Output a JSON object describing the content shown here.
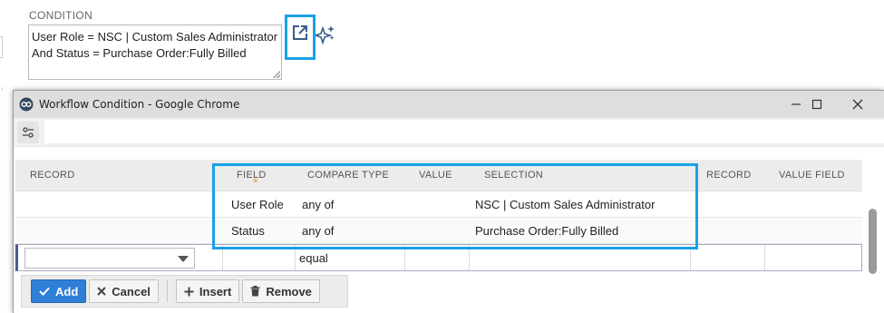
{
  "background": {
    "condition_label": "CONDITION",
    "condition_text": "User Role = NSC | Custom Sales Administrator And Status = Purchase Order:Fully Billed"
  },
  "icons": {
    "open_popup": "open-external-icon",
    "ai_assist": "sparkle-icon"
  },
  "popup": {
    "title": "Workflow Condition - Google Chrome",
    "window_controls": [
      "minimize",
      "maximize",
      "close"
    ],
    "grid": {
      "headers": [
        "RECORD",
        "FIELD",
        "COMPARE TYPE",
        "VALUE",
        "SELECTION",
        "RECORD",
        "VALUE FIELD"
      ],
      "required_marker": "*",
      "rows": [
        {
          "record": "",
          "field": "User Role",
          "compare_type": "any of",
          "value": "",
          "selection": "NSC | Custom Sales Administrator",
          "record2": "",
          "value_field": ""
        },
        {
          "record": "",
          "field": "Status",
          "compare_type": "any of",
          "value": "",
          "selection": "Purchase Order:Fully Billed",
          "record2": "",
          "value_field": ""
        }
      ],
      "edit_row": {
        "record_select": "",
        "compare_type": "equal"
      }
    },
    "buttons": {
      "add": "Add",
      "cancel": "Cancel",
      "insert": "Insert",
      "remove": "Remove"
    }
  },
  "colors": {
    "highlight": "#1aa1e6",
    "primary_button": "#2f7fd8",
    "required_asterisk": "#e8a33a"
  }
}
